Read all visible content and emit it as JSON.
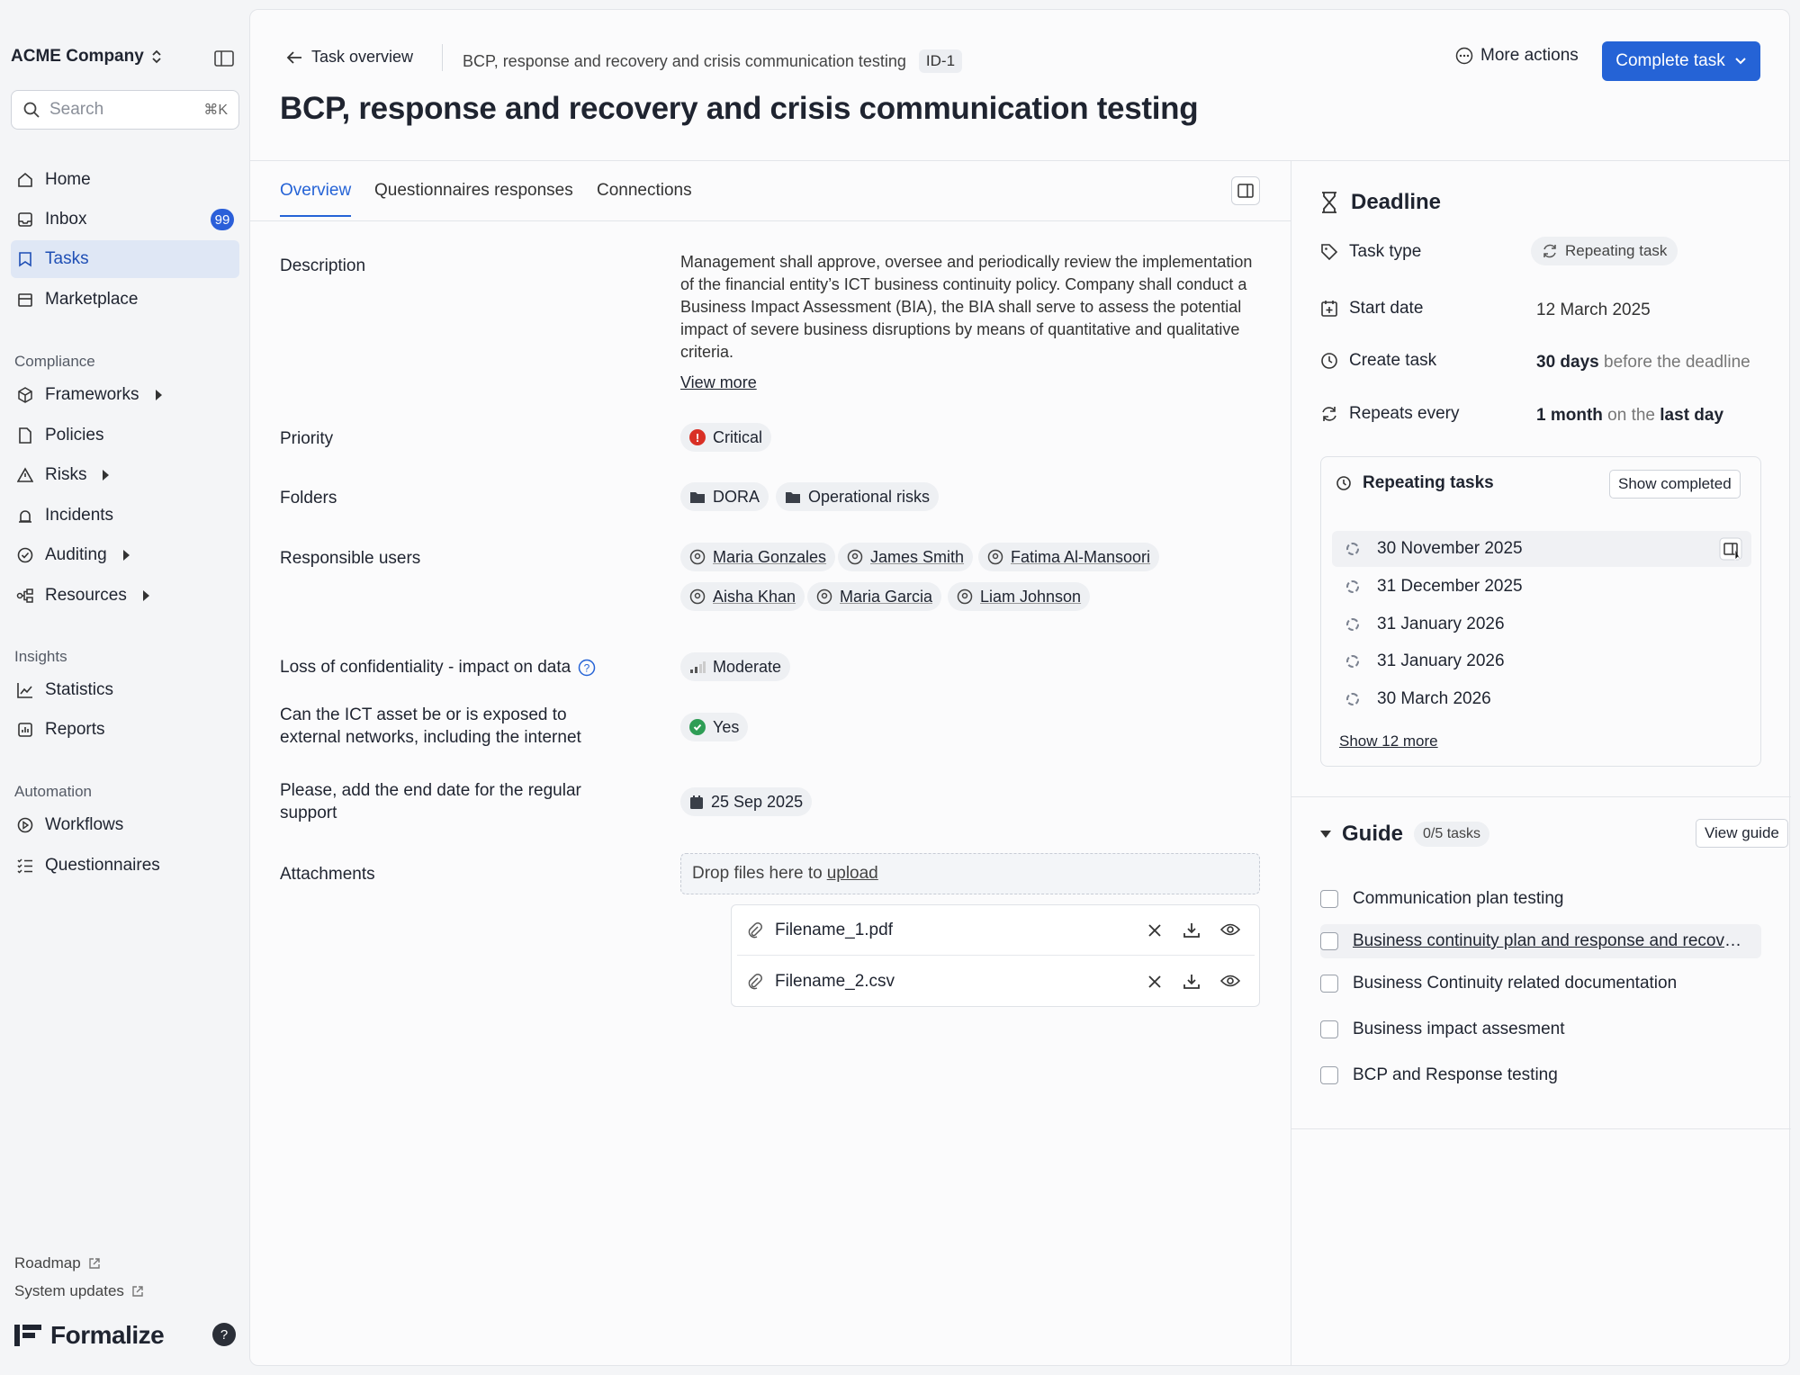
{
  "sidebar": {
    "company": "ACME Company",
    "search_placeholder": "Search",
    "search_shortcut": "⌘K",
    "main_items": [
      {
        "label": "Home",
        "icon": "home-icon"
      },
      {
        "label": "Inbox",
        "icon": "inbox-icon",
        "badge": "99"
      },
      {
        "label": "Tasks",
        "icon": "tasks-icon",
        "active": true
      },
      {
        "label": "Marketplace",
        "icon": "store-icon"
      }
    ],
    "compliance_label": "Compliance",
    "compliance_items": [
      {
        "label": "Frameworks",
        "icon": "cube-icon",
        "expandable": true
      },
      {
        "label": "Policies",
        "icon": "document-icon"
      },
      {
        "label": "Risks",
        "icon": "warning-icon",
        "expandable": true
      },
      {
        "label": "Incidents",
        "icon": "siren-icon"
      },
      {
        "label": "Auditing",
        "icon": "shield-check-icon",
        "expandable": true
      },
      {
        "label": "Resources",
        "icon": "network-icon",
        "expandable": true
      }
    ],
    "insights_label": "Insights",
    "insights_items": [
      {
        "label": "Statistics",
        "icon": "chart-line-icon"
      },
      {
        "label": "Reports",
        "icon": "report-icon"
      }
    ],
    "automation_label": "Automation",
    "automation_items": [
      {
        "label": "Workflows",
        "icon": "play-circle-icon"
      },
      {
        "label": "Questionnaires",
        "icon": "list-check-icon"
      }
    ],
    "footer_links": [
      "Roadmap",
      "System updates"
    ],
    "brand": "Formalize",
    "help": "?"
  },
  "header": {
    "back_label": "Task overview",
    "breadcrumb": "BCP, response and recovery and crisis communication testing",
    "id_badge": "ID-1",
    "title": "BCP, response and recovery and crisis communication testing",
    "more_actions": "More actions",
    "complete_task": "Complete task"
  },
  "tabs": [
    "Overview",
    "Questionnaires responses",
    "Connections"
  ],
  "overview": {
    "description_label": "Description",
    "description": "Management shall approve, oversee and periodically review the implementation of the financial entity’s ICT business continuity policy. Company shall conduct a Business Impact Assessment (BIA), the BIA shall serve to assess the potential impact of severe business disruptions by means of quantitative and qualitative criteria.",
    "view_more": "View more",
    "priority_label": "Priority",
    "priority": "Critical",
    "folders_label": "Folders",
    "folders": [
      "DORA",
      "Operational risks"
    ],
    "users_label": "Responsible users",
    "users": [
      "Maria Gonzales",
      "James Smith",
      "Fatima Al-Mansoori",
      "Aisha Khan",
      "Maria Garcia",
      "Liam Johnson"
    ],
    "confidentiality_label": "Loss of confidentiality - impact on data",
    "confidentiality": "Moderate",
    "exposed_label": "Can the ICT asset be or is exposed to external networks, including the internet",
    "exposed": "Yes",
    "end_date_label": "Please, add the end date for the regular support",
    "end_date": "25 Sep 2025",
    "attachments_label": "Attachments",
    "dropzone_text": "Drop files here to",
    "dropzone_link": "upload",
    "files": [
      "Filename_1.pdf",
      "Filename_2.csv"
    ]
  },
  "deadline": {
    "title": "Deadline",
    "task_type_label": "Task type",
    "task_type": "Repeating task",
    "start_date_label": "Start date",
    "start_date": "12 March 2025",
    "create_task_label": "Create task",
    "create_task_value": "30 days",
    "create_task_suffix": "before the deadline",
    "repeats_label": "Repeats every",
    "repeats_value": "1 month",
    "repeats_mid": "on the",
    "repeats_end": "last day",
    "repeating_title": "Repeating tasks",
    "show_completed": "Show completed",
    "repeating_dates": [
      "30 November 2025",
      "31 December 2025",
      "31 January 2026",
      "31 January 2026",
      "30 March 2026"
    ],
    "show_more": "Show 12 more"
  },
  "guide": {
    "title": "Guide",
    "count": "0/5 tasks",
    "view_guide": "View guide",
    "items": [
      "Communication plan testing",
      "Business continuity plan and response and recovery testing",
      "Business Continuity related documentation",
      "Business impact assesment",
      "BCP and Response testing"
    ]
  },
  "colors": {
    "accent": "#2563d6",
    "critical": "#d93025",
    "success": "#2e9d55"
  }
}
